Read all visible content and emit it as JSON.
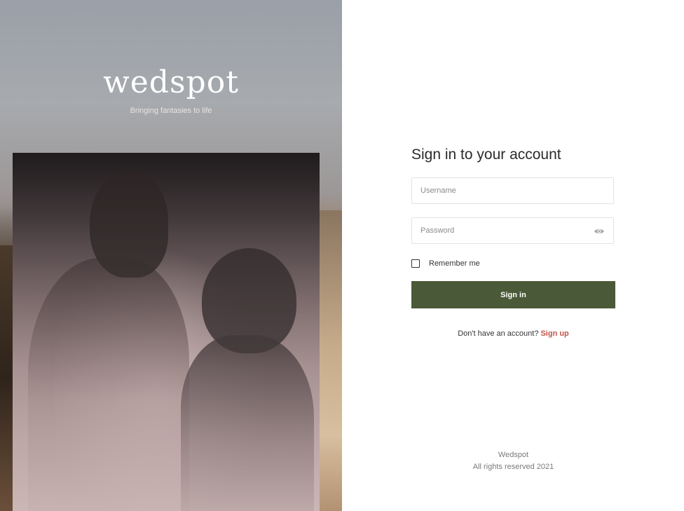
{
  "brand": {
    "logo_text": "wedspot",
    "tagline": "Bringing fantasies to life"
  },
  "form": {
    "title": "Sign in to your account",
    "username_placeholder": "Username",
    "password_placeholder": "Password",
    "remember_label": "Remember me",
    "submit_label": "Sign in",
    "signup_prompt": "Don't have an account?",
    "signup_link": "Sign up"
  },
  "footer": {
    "company": "Wedspot",
    "copyright": "All rights reserved 2021"
  },
  "colors": {
    "primary_button": "#4a5937",
    "link_accent": "#c0554a"
  },
  "icons": {
    "password_toggle": "eye-icon",
    "remember": "checkbox"
  }
}
